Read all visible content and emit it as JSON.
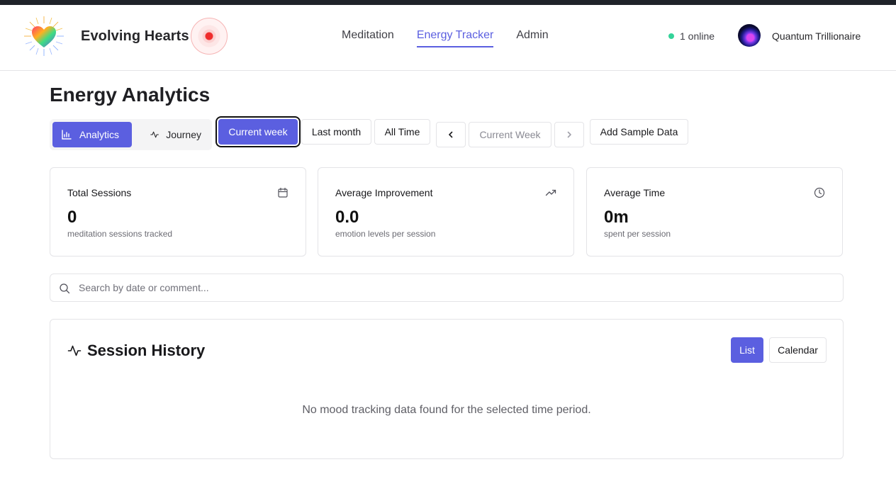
{
  "header": {
    "brand": "Evolving Hearts",
    "nav": [
      {
        "label": "Meditation",
        "active": false
      },
      {
        "label": "Energy Tracker",
        "active": true
      },
      {
        "label": "Admin",
        "active": false
      }
    ],
    "online_text": "1 online",
    "username": "Quantum Trillionaire"
  },
  "page": {
    "title": "Energy Analytics"
  },
  "toolbar": {
    "view_tabs": [
      {
        "label": "Analytics",
        "icon": "bar-chart-icon",
        "active": true
      },
      {
        "label": "Journey",
        "icon": "activity-icon",
        "active": false
      }
    ],
    "ranges": [
      {
        "label": "Current week",
        "active": true
      },
      {
        "label": "Last month",
        "active": false
      },
      {
        "label": "All Time",
        "active": false
      }
    ],
    "period_label": "Current Week",
    "add_sample": "Add Sample Data"
  },
  "stats": [
    {
      "title": "Total Sessions",
      "value": "0",
      "sub": "meditation sessions tracked",
      "icon": "calendar-icon"
    },
    {
      "title": "Average Improvement",
      "value": "0.0",
      "sub": "emotion levels per session",
      "icon": "trending-up-icon"
    },
    {
      "title": "Average Time",
      "value": "0m",
      "sub": "spent per session",
      "icon": "clock-icon"
    }
  ],
  "search": {
    "placeholder": "Search by date or comment...",
    "value": ""
  },
  "history": {
    "title": "Session History",
    "views": [
      {
        "label": "List",
        "active": true
      },
      {
        "label": "Calendar",
        "active": false
      }
    ],
    "empty_text": "No mood tracking data found for the selected time period."
  },
  "colors": {
    "accent": "#5b5fe0",
    "online": "#34d399",
    "topbar": "#1f2329"
  }
}
